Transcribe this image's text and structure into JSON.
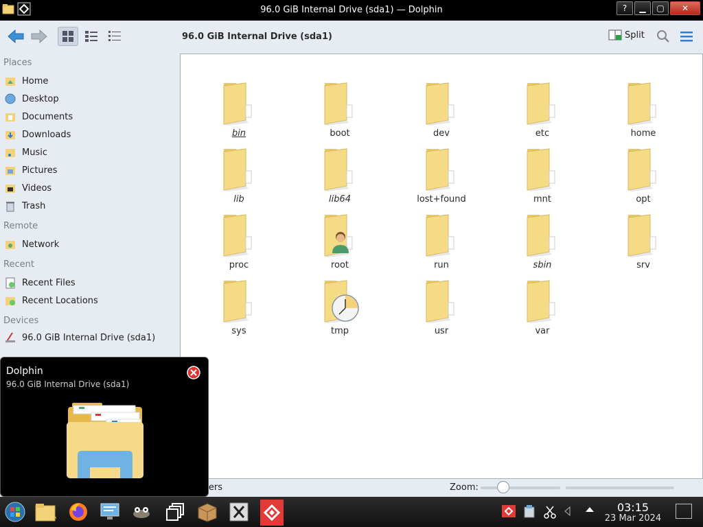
{
  "window": {
    "title": "96.0 GiB Internal Drive (sda1) — Dolphin",
    "buttons": {
      "help": "?",
      "minimize": "▁",
      "maximize": "▢",
      "close": "✕"
    }
  },
  "toolbar": {
    "location": "96.0 GiB Internal Drive (sda1)",
    "split_label": "Split"
  },
  "sidebar": {
    "sections": {
      "places": "Places",
      "remote": "Remote",
      "recent": "Recent",
      "devices": "Devices"
    },
    "places": [
      "Home",
      "Desktop",
      "Documents",
      "Downloads",
      "Music",
      "Pictures",
      "Videos",
      "Trash"
    ],
    "remote": [
      "Network"
    ],
    "recent": [
      "Recent Files",
      "Recent Locations"
    ],
    "devices": [
      "96.0 GiB Internal Drive (sda1)"
    ],
    "device_usage_fraction": 0.22
  },
  "folders": [
    {
      "name": "bin",
      "style": "italic-underline"
    },
    {
      "name": "boot",
      "style": "normal"
    },
    {
      "name": "dev",
      "style": "normal"
    },
    {
      "name": "etc",
      "style": "normal"
    },
    {
      "name": "home",
      "style": "normal"
    },
    {
      "name": "lib",
      "style": "italic"
    },
    {
      "name": "lib64",
      "style": "italic"
    },
    {
      "name": "lost+found",
      "style": "normal"
    },
    {
      "name": "mnt",
      "style": "normal"
    },
    {
      "name": "opt",
      "style": "normal"
    },
    {
      "name": "proc",
      "style": "normal"
    },
    {
      "name": "root",
      "style": "normal",
      "overlay": "user"
    },
    {
      "name": "run",
      "style": "normal"
    },
    {
      "name": "sbin",
      "style": "italic"
    },
    {
      "name": "srv",
      "style": "normal"
    },
    {
      "name": "sys",
      "style": "normal"
    },
    {
      "name": "tmp",
      "style": "normal",
      "overlay": "clock"
    },
    {
      "name": "usr",
      "style": "normal"
    },
    {
      "name": "var",
      "style": "normal"
    }
  ],
  "statusbar": {
    "text": "lders",
    "zoom_label": "Zoom:"
  },
  "tooltip": {
    "title": "Dolphin",
    "subtitle": "96.0 GiB Internal Drive (sda1)"
  },
  "taskbar": {
    "apps": [
      "start-orb",
      "file-manager",
      "firefox",
      "system-settings",
      "gimp",
      "task-switcher",
      "package-manager",
      "xterm",
      "anydesk"
    ],
    "clock_time": "03:15",
    "clock_date": "23 Mar 2024"
  },
  "colors": {
    "accent": "#3daee9",
    "window_bg": "#e6ecf2",
    "folder_yellow": "#f3d27a",
    "taskbar_active": "#e23a36"
  }
}
